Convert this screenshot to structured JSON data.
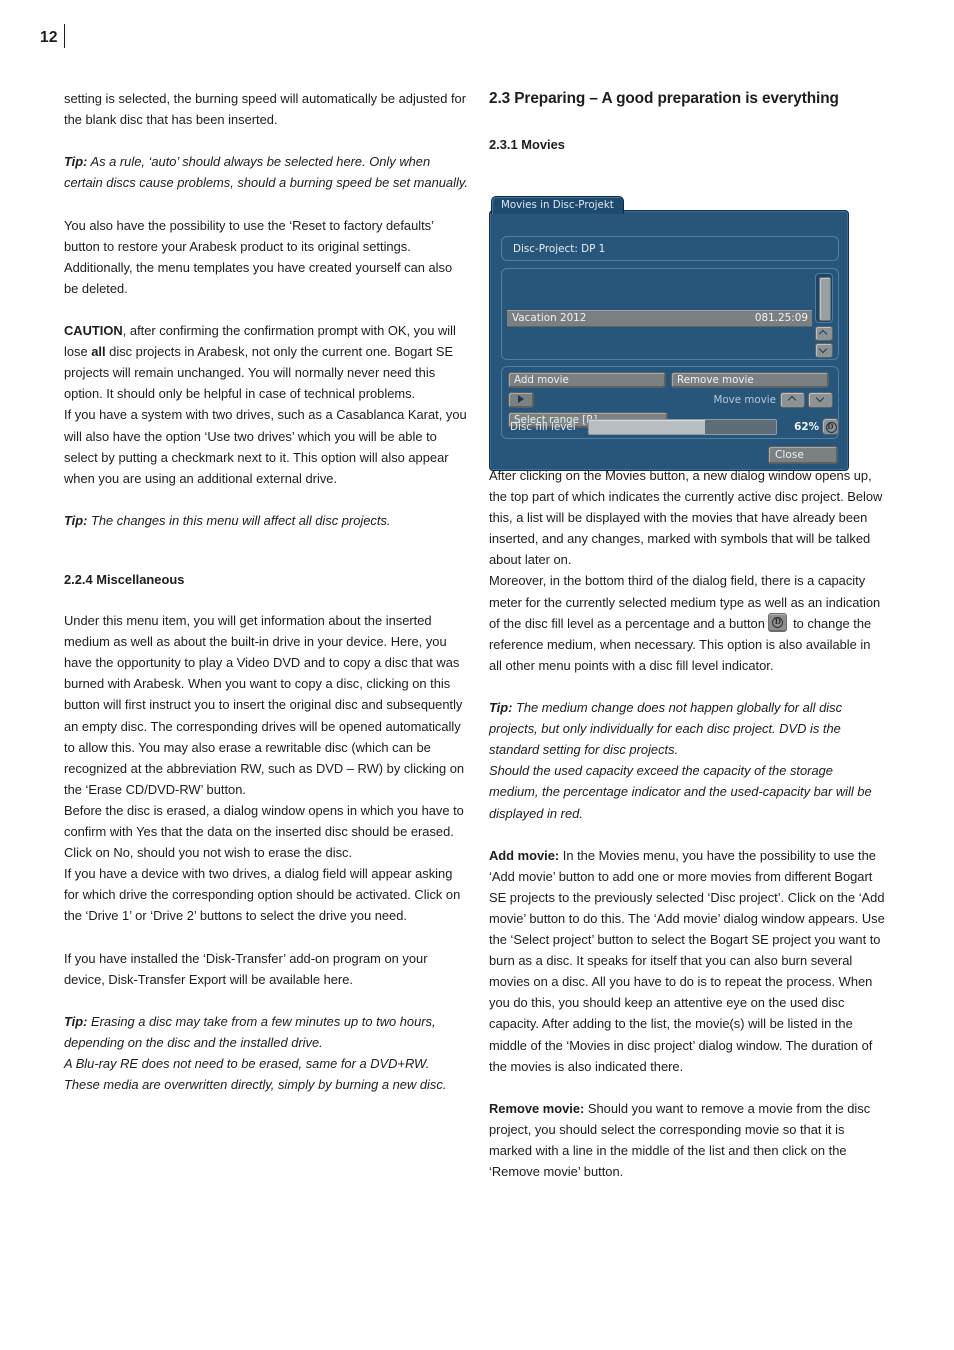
{
  "page": {
    "number": "12"
  },
  "left_column": {
    "paragraphs": [
      {
        "id": "p1",
        "text": "setting is selected, the burning speed will automatically be adjusted for the blank disc that has been inserted."
      },
      {
        "id": "tip1_label",
        "text": "Tip:"
      },
      {
        "id": "tip1",
        "text": " As a rule, ‘auto’ should always be selected here. Only when certain discs cause problems, should a burning speed be set manually."
      },
      {
        "id": "p2",
        "text": "You also have the possibility to use the ‘Reset to factory defaults’ button to restore your Arabesk product to its original settings. Additionally, the menu templates you have created yourself can also be deleted."
      },
      {
        "id": "caution_label",
        "text": "CAUTION"
      },
      {
        "id": "caution_a",
        "text": ", after confirming the confirmation prompt with OK, you will lose  "
      },
      {
        "id": "caution_all",
        "text": "all"
      },
      {
        "id": "caution_b",
        "text": " disc projects in Arabesk, not only the current one. Bogart SE projects will remain unchanged. You will normally never need this option. It should only be helpful in case of technical problems."
      },
      {
        "id": "p3",
        "text": "If you have a system with two drives, such as a Casablanca Karat, you will also have the option ‘Use two drives’ which you will be able to select by putting a checkmark next to it. This option will also appear when you are using an additional external drive."
      },
      {
        "id": "tip2_label",
        "text": "Tip:"
      },
      {
        "id": "tip2",
        "text": " The changes in this menu will affect all disc projects."
      },
      {
        "id": "heading_224",
        "text": "2.2.4 Miscellaneous"
      },
      {
        "id": "p4",
        "text": "Under this menu item, you will get information about the inserted medium as well as about the built-in drive in your device. Here, you have the opportunity to play a Video DVD and to copy a disc that was burned with Arabesk. When you want to copy a disc, clicking on this button will first instruct you to insert the original disc and subsequently an empty disc. The corresponding drives will be opened automatically to allow this. You may also erase a rewritable disc (which can be recognized at the abbreviation RW, such as DVD – RW) by clicking on the ‘Erase CD/DVD-RW’ button."
      },
      {
        "id": "p5",
        "text": "Before the disc is erased, a dialog window opens in which you have to confirm with Yes that the data on the inserted disc should be erased. Click on No, should you not wish to erase the disc."
      },
      {
        "id": "p6",
        "text": "If you have a device with two drives, a dialog field will appear asking for which drive the corresponding option should be activated. Click on the ‘Drive 1’ or ‘Drive 2’ buttons to select the drive you need."
      },
      {
        "id": "p7",
        "text": "If you have installed the ‘Disk-Transfer’ add-on program on your device, Disk-Transfer Export will be available here."
      },
      {
        "id": "tip3_label",
        "text": "Tip:"
      },
      {
        "id": "tip3",
        "text": " Erasing a disc may take from a few minutes up to two hours, depending on the disc and the installed drive."
      },
      {
        "id": "tip3b",
        "text": "A Blu-ray RE does not need to be erased, same for a DVD+RW. These media are overwritten directly, simply by burning a new disc."
      }
    ]
  },
  "right_column": {
    "heading_23": "2.3 Preparing – A good preparation is everything",
    "heading_231": "2.3.1 Movies",
    "paragraphs": [
      {
        "id": "r1",
        "text": "After clicking on the Movies button, a new dialog window opens up, the top part of which indicates the currently active disc project. Below this, a list will be displayed with the movies that have already been inserted, and any changes, marked with symbols that will be talked about later on."
      },
      {
        "id": "r2a",
        "text": "Moreover, in the bottom third of the dialog field, there is a capacity meter for the currently selected medium type as well as an indication of the disc fill level as a percentage and a button "
      },
      {
        "id": "r2b",
        "text": " to change the reference medium, when necessary. This option is also available in all other menu points with a disc fill level indicator."
      },
      {
        "id": "tip4_label",
        "text": "Tip:"
      },
      {
        "id": "tip4",
        "text": " The medium change does not happen globally for all disc projects, but only individually for each disc project. DVD is the standard setting for disc projects."
      },
      {
        "id": "tip4b",
        "text": "Should the used capacity exceed the capacity of the storage medium, the percentage indicator and the used-capacity bar will be displayed in red."
      },
      {
        "id": "add_label",
        "text": "Add movie:"
      },
      {
        "id": "add_text",
        "text": " In the Movies menu, you have the possibility to use the ‘Add movie’ button to add one or more movies from different Bogart SE projects to the previously selected ‘Disc project’. Click on the ‘Add movie’ button to do this. The ‘Add movie’ dialog window appears. Use the ‘Select project’ button to select the Bogart SE project you want to burn as a disc. It speaks for itself that you can also burn several movies on a disc. All you have to do is to repeat the process. When you do this, you should keep an attentive eye on the used disc capacity. After adding to the list, the movie(s) will be listed in the middle of the ‘Movies in disc project’ dialog window. The duration of the movies is also indicated there."
      },
      {
        "id": "remove_label",
        "text": "Remove movie:"
      },
      {
        "id": "remove_text",
        "text": " Should you want to remove a movie from the disc project, you should select the corresponding movie so that it is marked with a line in the middle of the list and then click on the ‘Remove movie’ button."
      }
    ],
    "inline_icon_name": "disc-medium-icon",
    "inline_icon_glyph": "D"
  },
  "screenshot": {
    "tab_title": "Movies in Disc-Projekt",
    "project_field": "Disc-Project: DP 1",
    "list": {
      "columns": [
        "name",
        "duration"
      ],
      "rows": [
        {
          "name": "Vacation  2012",
          "duration": "081.25:09"
        }
      ]
    },
    "buttons": {
      "add_movie": "Add movie",
      "remove_movie": "Remove movie",
      "select_range": "Select range [R]",
      "close": "Close",
      "play_icon": "play-icon",
      "move_movie_label": "Move movie",
      "move_up_icon": "chevron-up-icon",
      "move_down_icon": "chevron-down-icon",
      "disc_medium_icon": "disc-medium-icon",
      "disc_medium_glyph": "D"
    },
    "disc_fill": {
      "label": "Disc fill level",
      "percent_text": "62%",
      "percent_value": 62
    },
    "scrollbar": {
      "up_icon": "chevron-up-icon",
      "down_icon": "chevron-down-icon"
    },
    "colors": {
      "dialog_bg": "#27567a",
      "panel_border": "#4d7fa4",
      "tab_bg": "#1d4a6e",
      "button_gray": "#7b8082",
      "row_selected": "#7a7f81",
      "fill_bar": "#b9bec0"
    }
  }
}
